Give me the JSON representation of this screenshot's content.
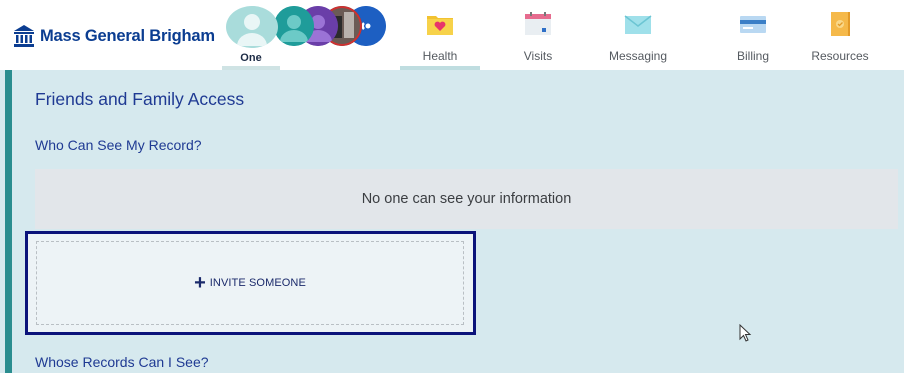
{
  "header": {
    "brand": "Mass General Brigham",
    "active_profile_label": "One",
    "nav": [
      {
        "label": "Health",
        "icon": "health-folder-icon"
      },
      {
        "label": "Visits",
        "icon": "calendar-icon"
      },
      {
        "label": "Messaging",
        "icon": "envelope-icon"
      },
      {
        "label": "Billing",
        "icon": "credit-card-icon"
      },
      {
        "label": "Resources",
        "icon": "resources-book-icon"
      }
    ]
  },
  "main": {
    "title": "Friends and Family Access",
    "who_can_see_heading": "Who Can See My Record?",
    "empty_message": "No one can see your information",
    "invite_label": "INVITE SOMEONE",
    "whose_records_heading": "Whose Records Can I See?"
  },
  "colors": {
    "brand": "#0b3d91",
    "accent_bar": "#2a8d8f",
    "background": "#d6e9ee",
    "focus_border": "#0b137a"
  }
}
